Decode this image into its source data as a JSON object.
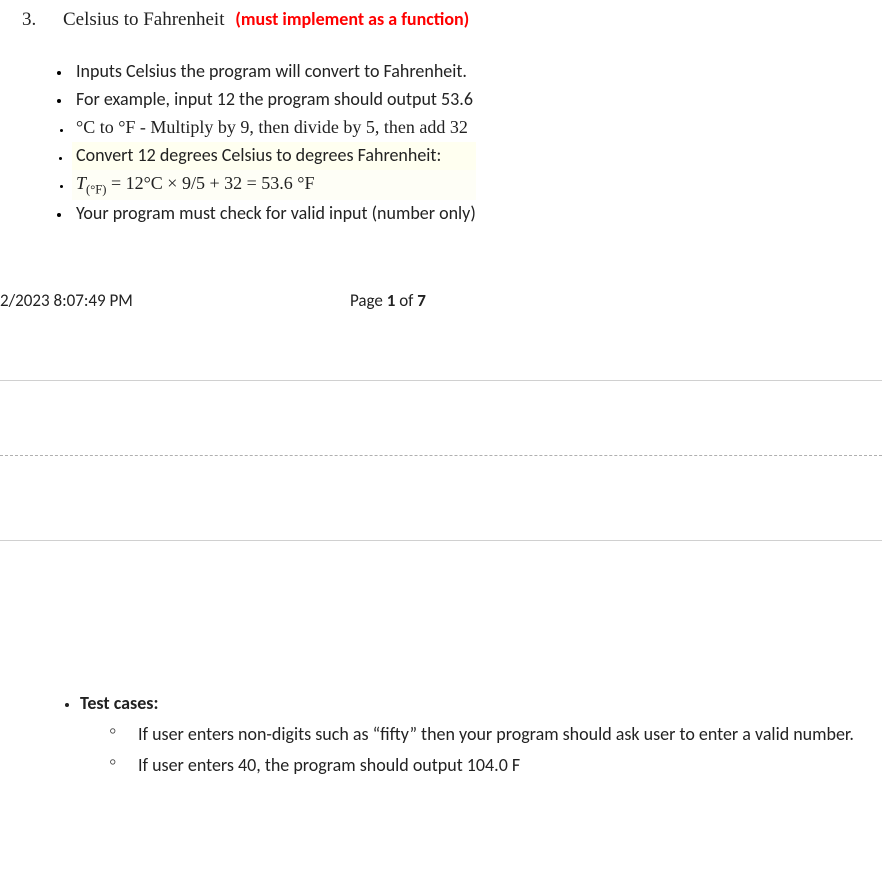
{
  "heading": {
    "number": "3.",
    "title": "Celsius to Fahrenheit",
    "note": "(must implement as a function)"
  },
  "bullets": {
    "b0": "Inputs Celsius the program will convert to Fahrenheit.",
    "b1": "For example, input 12 the program should output 53.6",
    "b2": "°C to °F - Multiply by 9, then divide by 5, then add 32",
    "b3": "Convert 12 degrees Celsius to degrees Fahrenheit:",
    "b4_T": "T",
    "b4_sub": "(°F)",
    "b4_rest": " = 12°C × 9/5 + 32 = 53.6 °F",
    "b5": "Your program must check for valid input (number only)"
  },
  "footer": {
    "timestamp": "2/2023 8:07:49 PM",
    "page_pre": "Page ",
    "page_cur": "1",
    "page_mid": " of ",
    "page_tot": "7"
  },
  "tests": {
    "label": "Test cases:",
    "t0": "If user enters non-digits such as “fifty” then your program should ask user to enter a valid number.",
    "t1": "If user enters 40, the program should output 104.0 F"
  }
}
